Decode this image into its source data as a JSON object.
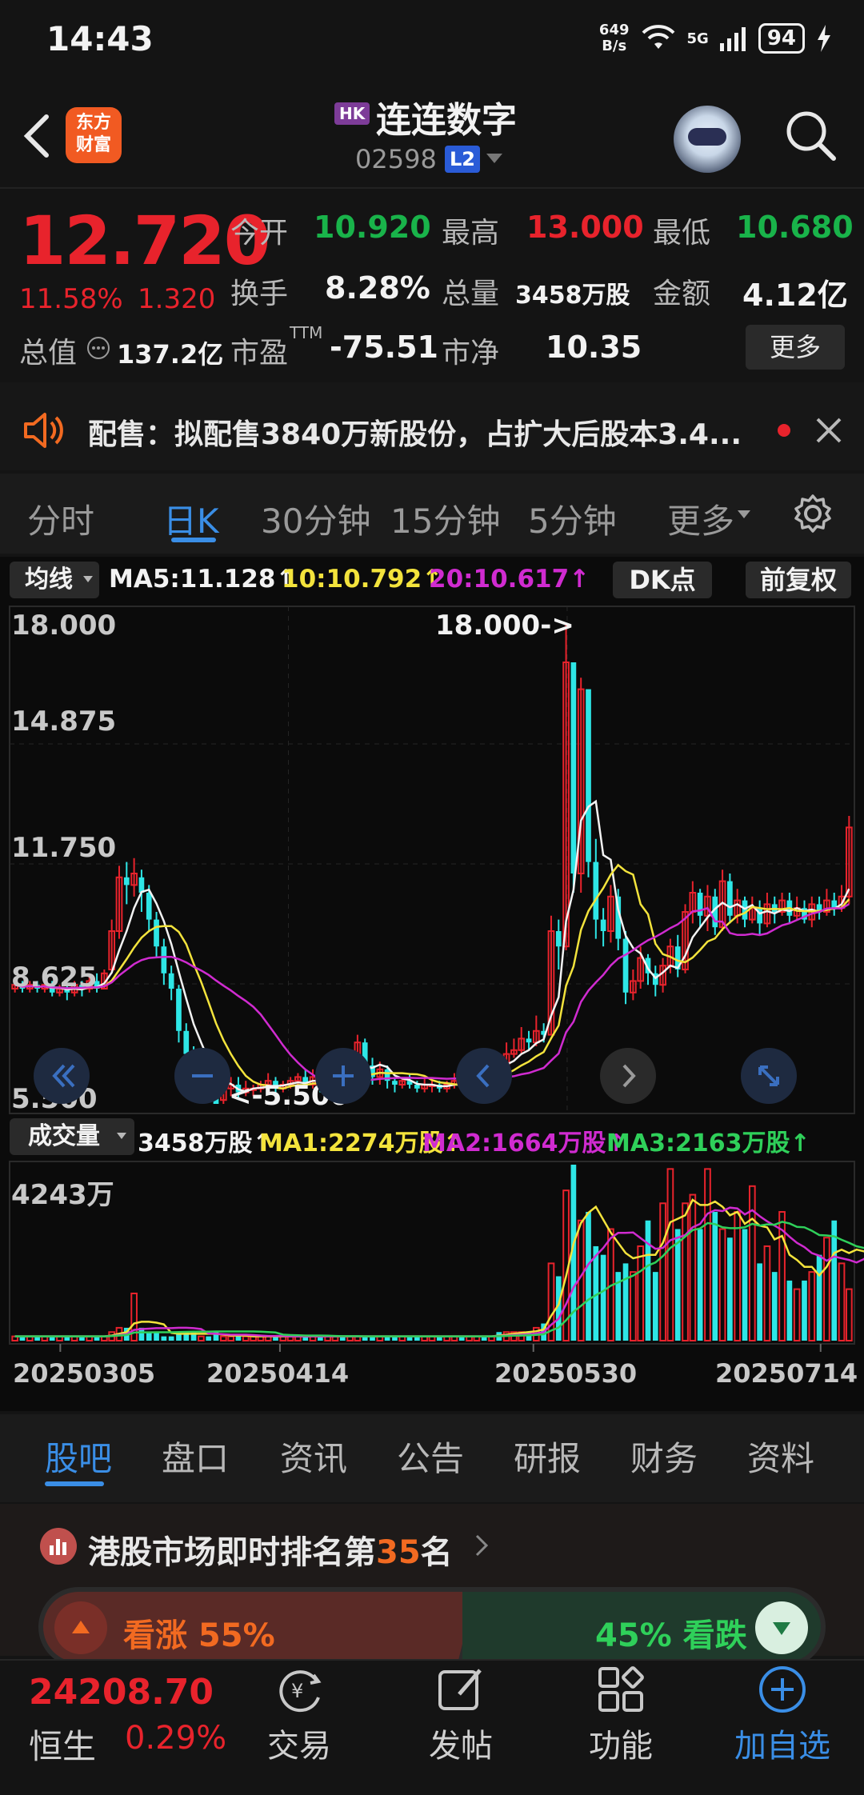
{
  "status": {
    "time": "14:43",
    "net_speed_top": "649",
    "net_speed_bottom": "B/s",
    "network": "5G",
    "battery": "94"
  },
  "header": {
    "app_logo_line1": "东方",
    "app_logo_line2": "财富",
    "market_badge": "HK",
    "name": "连连数字",
    "code": "02598",
    "level_badge": "L2"
  },
  "quote": {
    "price": "12.720",
    "change_pct": "11.58%",
    "change": "1.320",
    "open_label": "今开",
    "open": "10.920",
    "high_label": "最高",
    "high": "13.000",
    "low_label": "最低",
    "low": "10.680",
    "turnover_label": "换手",
    "turnover": "8.28%",
    "volume_label": "总量",
    "volume": "3458万股",
    "amount_label": "金额",
    "amount": "4.12亿",
    "mktcap_label": "总值",
    "mktcap": "137.2亿",
    "pe_label": "市盈",
    "pe_sup": "TTM",
    "pe": "-75.51",
    "pb_label": "市净",
    "pb": "10.35",
    "more_button": "更多"
  },
  "notice": {
    "text": "配售：拟配售3840万新股份，占扩大后股本3.4..."
  },
  "chart_tabs": {
    "items": [
      "分时",
      "日K",
      "30分钟",
      "15分钟",
      "5分钟",
      "更多"
    ],
    "active": 1
  },
  "ma_legend": {
    "selector": "均线",
    "ma5": "MA5:11.128↑",
    "ma10": "10:10.792↑",
    "ma20": "20:10.617↑",
    "dk_button": "DK点",
    "adjust_button": "前复权"
  },
  "vol_legend": {
    "selector": "成交量",
    "vol": "3458万股↑",
    "ma1": "MA1:2274万股↑",
    "ma2": "MA2:1664万股↑",
    "ma3": "MA3:2163万股↑",
    "max_label": "4243万"
  },
  "price_axis": [
    "18.000",
    "14.875",
    "11.750",
    "8.625",
    "5.500"
  ],
  "annotations": {
    "high": "18.000->",
    "low": "<-5.500"
  },
  "dates": [
    "20250305",
    "20250414",
    "20250530",
    "20250714"
  ],
  "chart_data": {
    "type": "candlestick",
    "ylim": [
      5.5,
      18.0
    ],
    "candles": [
      [
        8.5,
        8.6,
        8.7,
        8.4
      ],
      [
        8.6,
        8.5,
        8.7,
        8.4
      ],
      [
        8.5,
        8.6,
        8.7,
        8.4
      ],
      [
        8.6,
        8.5,
        8.7,
        8.4
      ],
      [
        8.5,
        8.6,
        8.8,
        8.4
      ],
      [
        8.6,
        8.4,
        8.7,
        8.3
      ],
      [
        8.4,
        8.5,
        8.6,
        8.3
      ],
      [
        8.5,
        8.4,
        8.6,
        8.2
      ],
      [
        8.4,
        8.6,
        8.7,
        8.3
      ],
      [
        8.6,
        8.5,
        8.7,
        8.3
      ],
      [
        8.5,
        8.7,
        8.8,
        8.4
      ],
      [
        8.7,
        8.5,
        8.9,
        8.4
      ],
      [
        8.5,
        8.9,
        9.0,
        8.5
      ],
      [
        9.0,
        10.0,
        10.3,
        8.9
      ],
      [
        10.0,
        11.4,
        11.7,
        9.8
      ],
      [
        11.4,
        11.2,
        11.8,
        10.7
      ],
      [
        11.2,
        11.5,
        11.9,
        10.9
      ],
      [
        11.4,
        11.0,
        11.6,
        10.5
      ],
      [
        11.0,
        10.3,
        11.2,
        10.0
      ],
      [
        10.3,
        9.6,
        10.5,
        9.3
      ],
      [
        9.6,
        8.9,
        9.8,
        8.6
      ],
      [
        8.9,
        8.5,
        9.1,
        8.2
      ],
      [
        8.5,
        7.4,
        8.6,
        7.1
      ],
      [
        7.4,
        6.8,
        7.6,
        6.6
      ],
      [
        6.8,
        6.3,
        7.0,
        6.0
      ],
      [
        6.3,
        6.5,
        6.7,
        6.1
      ],
      [
        6.5,
        6.2,
        6.9,
        5.9
      ],
      [
        6.2,
        5.5,
        6.3,
        5.5
      ],
      [
        5.6,
        5.9,
        6.1,
        5.5
      ],
      [
        5.9,
        6.0,
        6.2,
        5.7
      ],
      [
        6.0,
        5.8,
        6.2,
        5.6
      ],
      [
        5.8,
        5.9,
        6.1,
        5.7
      ],
      [
        5.9,
        5.9,
        6.0,
        5.7
      ],
      [
        5.9,
        6.0,
        6.1,
        5.8
      ],
      [
        6.0,
        6.1,
        6.3,
        5.8
      ],
      [
        6.1,
        5.9,
        6.2,
        5.8
      ],
      [
        5.9,
        6.0,
        6.1,
        5.8
      ],
      [
        6.0,
        6.1,
        6.2,
        5.9
      ],
      [
        6.1,
        6.2,
        6.3,
        5.9
      ],
      [
        6.2,
        6.0,
        6.4,
        5.9
      ],
      [
        6.0,
        6.2,
        6.4,
        5.9
      ],
      [
        6.2,
        6.0,
        6.3,
        5.8
      ],
      [
        6.0,
        6.1,
        6.3,
        5.9
      ],
      [
        6.1,
        6.2,
        6.5,
        6.0
      ],
      [
        6.2,
        6.0,
        6.3,
        5.9
      ],
      [
        6.0,
        6.4,
        6.6,
        5.9
      ],
      [
        6.4,
        7.1,
        7.3,
        6.3
      ],
      [
        7.1,
        6.5,
        7.2,
        6.3
      ],
      [
        6.5,
        6.2,
        6.7,
        6.0
      ],
      [
        6.2,
        6.4,
        6.6,
        6.0
      ],
      [
        6.4,
        6.1,
        6.5,
        5.9
      ],
      [
        6.1,
        6.0,
        6.2,
        5.8
      ],
      [
        6.0,
        6.1,
        6.2,
        5.9
      ],
      [
        6.1,
        6.0,
        6.3,
        5.9
      ],
      [
        6.0,
        5.9,
        6.1,
        5.8
      ],
      [
        5.9,
        6.0,
        6.2,
        5.8
      ],
      [
        6.0,
        6.0,
        6.1,
        5.8
      ],
      [
        6.0,
        5.9,
        6.1,
        5.8
      ],
      [
        5.9,
        6.0,
        6.1,
        5.8
      ],
      [
        6.0,
        6.1,
        6.3,
        5.9
      ],
      [
        6.1,
        6.0,
        6.2,
        5.9
      ],
      [
        6.0,
        6.2,
        6.4,
        5.9
      ],
      [
        6.2,
        6.4,
        6.6,
        6.1
      ],
      [
        6.4,
        6.3,
        6.6,
        6.2
      ],
      [
        6.3,
        6.6,
        6.9,
        6.2
      ],
      [
        6.6,
        6.5,
        6.8,
        6.3
      ],
      [
        6.5,
        6.8,
        7.1,
        6.4
      ],
      [
        6.8,
        6.9,
        7.2,
        6.7
      ],
      [
        6.9,
        7.2,
        7.5,
        6.8
      ],
      [
        7.2,
        7.1,
        7.4,
        6.9
      ],
      [
        7.1,
        7.4,
        7.8,
        7.0
      ],
      [
        7.4,
        7.3,
        7.6,
        7.1
      ],
      [
        7.3,
        10.0,
        10.4,
        7.3
      ],
      [
        10.0,
        9.6,
        10.3,
        9.0
      ],
      [
        9.6,
        17.0,
        18.0,
        9.5
      ],
      [
        17.0,
        11.5,
        16.5,
        11.0
      ],
      [
        11.5,
        16.3,
        16.6,
        11.0
      ],
      [
        16.3,
        11.8,
        16.0,
        11.4
      ],
      [
        11.8,
        10.3,
        12.4,
        9.8
      ],
      [
        10.3,
        10.0,
        10.6,
        9.6
      ],
      [
        10.0,
        10.9,
        11.2,
        9.7
      ],
      [
        10.9,
        9.8,
        11.1,
        9.5
      ],
      [
        9.8,
        8.4,
        10.0,
        8.1
      ],
      [
        8.4,
        8.7,
        9.0,
        8.2
      ],
      [
        8.7,
        9.3,
        9.6,
        8.5
      ],
      [
        9.3,
        8.9,
        9.4,
        8.6
      ],
      [
        8.9,
        8.6,
        9.1,
        8.3
      ],
      [
        8.6,
        9.1,
        9.3,
        8.4
      ],
      [
        9.1,
        9.6,
        9.8,
        8.9
      ],
      [
        9.6,
        9.0,
        9.9,
        8.8
      ],
      [
        9.0,
        10.5,
        10.7,
        8.9
      ],
      [
        10.5,
        11.0,
        11.3,
        10.2
      ],
      [
        11.0,
        10.4,
        11.1,
        10.1
      ],
      [
        10.4,
        10.9,
        11.2,
        10.0
      ],
      [
        10.9,
        10.1,
        11.1,
        9.9
      ],
      [
        10.1,
        11.3,
        11.6,
        10.0
      ],
      [
        11.3,
        10.4,
        11.5,
        10.2
      ],
      [
        10.4,
        10.8,
        11.1,
        10.2
      ],
      [
        10.8,
        10.3,
        10.9,
        10.1
      ],
      [
        10.3,
        10.6,
        10.9,
        10.2
      ],
      [
        10.6,
        10.2,
        10.8,
        9.9
      ],
      [
        10.2,
        10.7,
        11.0,
        10.1
      ],
      [
        10.7,
        10.5,
        10.9,
        10.2
      ],
      [
        10.5,
        10.8,
        11.0,
        10.4
      ],
      [
        10.8,
        10.4,
        11.0,
        10.2
      ],
      [
        10.4,
        10.6,
        10.9,
        10.3
      ],
      [
        10.6,
        10.3,
        10.8,
        10.2
      ],
      [
        10.3,
        10.7,
        10.9,
        10.1
      ],
      [
        10.7,
        10.5,
        10.9,
        10.3
      ],
      [
        10.5,
        10.8,
        11.1,
        10.4
      ],
      [
        10.8,
        10.6,
        11.0,
        10.4
      ],
      [
        10.6,
        10.9,
        11.2,
        10.5
      ],
      [
        10.9,
        12.7,
        13.0,
        10.7
      ]
    ],
    "volumes": [
      1,
      1,
      1,
      1,
      1,
      1,
      1,
      1,
      1,
      1,
      1,
      1,
      1,
      2,
      3,
      3,
      11,
      3,
      2,
      2,
      1,
      1,
      2,
      2,
      2,
      1,
      1,
      2,
      1,
      1,
      1,
      1,
      1,
      1,
      1,
      1,
      1,
      1,
      1,
      1,
      1,
      1,
      1,
      1,
      1,
      1,
      1,
      1,
      1,
      1,
      1,
      1,
      1,
      1,
      1,
      1,
      1,
      1,
      1,
      1,
      1,
      1,
      1,
      1,
      1,
      2,
      2,
      2,
      2,
      2,
      3,
      4,
      18,
      15,
      35,
      41,
      28,
      30,
      22,
      20,
      26,
      16,
      18,
      16,
      22,
      28,
      16,
      32,
      40,
      26,
      32,
      34,
      26,
      40,
      30,
      26,
      24,
      30,
      26,
      36,
      18,
      22,
      16,
      30,
      14,
      12,
      14,
      16,
      20,
      24,
      28,
      18,
      12,
      24,
      22,
      30
    ]
  },
  "bottom_tabs": {
    "items": [
      "股吧",
      "盘口",
      "资讯",
      "公告",
      "研报",
      "财务",
      "资料"
    ],
    "active": 0
  },
  "rank": {
    "prefix": "港股市场即时排名第",
    "rank": "35",
    "suffix": "名"
  },
  "vote": {
    "up": "看涨 55%",
    "down": "45% 看跌"
  },
  "index": {
    "value": "24208.70",
    "name": "恒生",
    "change": "0.29%"
  },
  "nav": {
    "trade": "交易",
    "post": "发帖",
    "function": "功能",
    "add": "加自选"
  }
}
